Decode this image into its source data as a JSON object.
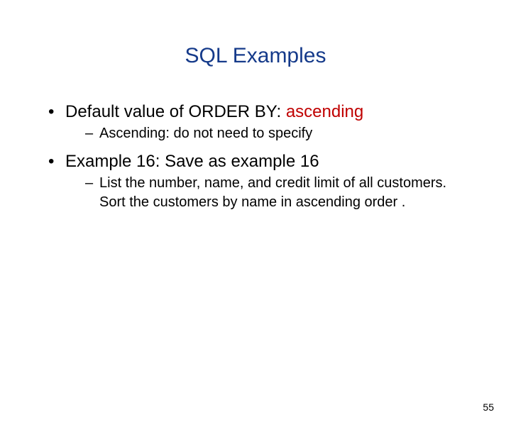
{
  "title": "SQL Examples",
  "bullets": [
    {
      "pre": "Default value of ORDER BY: ",
      "highlight": "ascending",
      "sub": [
        "Ascending: do not need to specify"
      ]
    },
    {
      "pre": "Example 16: Save as example 16",
      "highlight": "",
      "sub": [
        "List the number, name, and credit limit of all customers. Sort the customers by name in ascending order ."
      ]
    }
  ],
  "page_number": "55"
}
